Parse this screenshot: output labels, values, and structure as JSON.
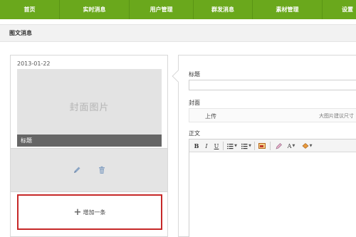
{
  "nav": {
    "items": [
      {
        "label": "首页"
      },
      {
        "label": "实时消息"
      },
      {
        "label": "用户管理"
      },
      {
        "label": "群发消息"
      },
      {
        "label": "素材管理"
      },
      {
        "label": "设置"
      }
    ]
  },
  "section": {
    "title": "图文消息"
  },
  "card": {
    "date": "2013-01-22",
    "cover_placeholder": "封面图片",
    "cover_caption": "标题",
    "edit_icon": "pencil-icon",
    "delete_icon": "trash-icon",
    "add_plus": "+",
    "add_label": "增加一条"
  },
  "editor_panel": {
    "title_label": "标题",
    "title_value": "",
    "cover_label": "封面",
    "upload_label": "上传",
    "cover_hint": "大图片建议尺寸",
    "body_label": "正文",
    "toolbar": {
      "bold": "B",
      "italic": "I",
      "underline": "U",
      "font_color": "A"
    }
  },
  "colors": {
    "nav_green": "#6aa81c",
    "highlight_red": "#c62828"
  }
}
